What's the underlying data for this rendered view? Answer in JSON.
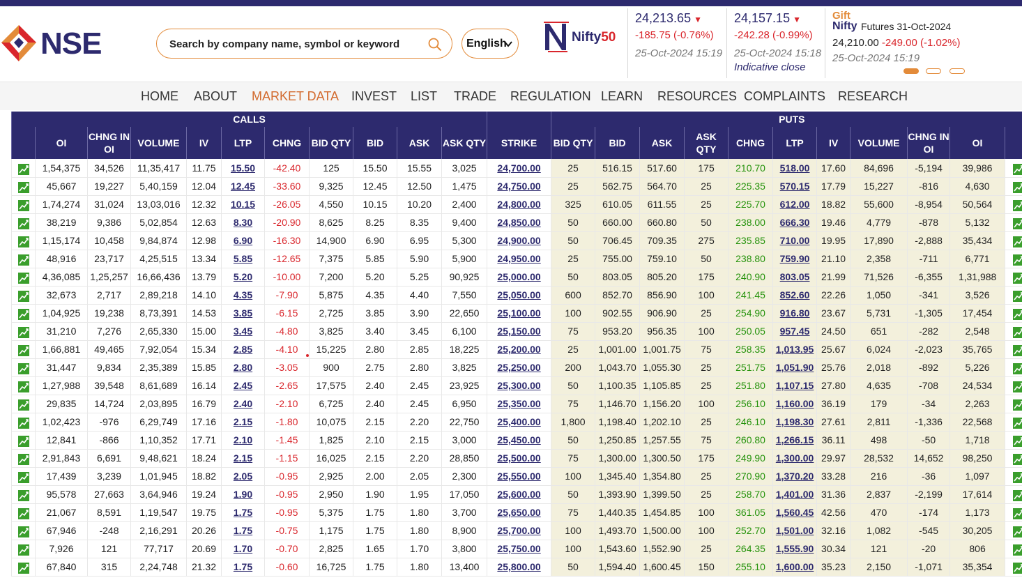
{
  "header": {
    "logo_text": "NSE",
    "search": {
      "placeholder": "Search by company name, symbol or keyword",
      "value": ""
    },
    "language": {
      "selected": "English"
    },
    "nifty_logo": {
      "brand": "Nifty",
      "suffix": "50"
    },
    "tickers": [
      {
        "value": "24,213.65",
        "change": "-185.75 (-0.76%)",
        "time": "25-Oct-2024 15:19",
        "note": ""
      },
      {
        "value": "24,157.15",
        "change": "-242.28 (-0.99%)",
        "time": "25-Oct-2024 15:18",
        "note": "Indicative close"
      }
    ],
    "gift": {
      "brand": "Gift",
      "nifty": "Nifty",
      "title": "Futures 31-Oct-2024",
      "price": "24,210.00",
      "change": "-249.00 (-1.02%)",
      "time": "25-Oct-2024 15:19"
    },
    "colors": {
      "brand": "#2d2a6e",
      "accent": "#e38b3a",
      "down": "#d9262c",
      "up": "#24920b",
      "puts_bg": "#f3f0dc"
    }
  },
  "nav": [
    "HOME",
    "ABOUT",
    "MARKET DATA",
    "INVEST",
    "LIST",
    "TRADE",
    "REGULATION",
    "LEARN",
    "RESOURCES",
    "COMPLAINTS",
    "RESEARCH"
  ],
  "nav_active": "MARKET DATA",
  "option_chain": {
    "calls_label": "CALLS",
    "puts_label": "PUTS",
    "columns": [
      "OI",
      "CHNG IN OI",
      "VOLUME",
      "IV",
      "LTP",
      "CHNG",
      "BID QTY",
      "BID",
      "ASK",
      "ASK QTY",
      "STRIKE",
      "BID QTY",
      "BID",
      "ASK",
      "ASK QTY",
      "CHNG",
      "LTP",
      "IV",
      "VOLUME",
      "CHNG IN OI",
      "OI"
    ],
    "rows": [
      [
        "1,54,375",
        "34,526",
        "11,35,417",
        "11.75",
        "15.50",
        "-42.40",
        "125",
        "15.50",
        "15.55",
        "3,025",
        "24,700.00",
        "25",
        "516.15",
        "517.60",
        "175",
        "210.70",
        "518.00",
        "17.60",
        "84,696",
        "-5,194",
        "39,986"
      ],
      [
        "45,667",
        "19,227",
        "5,40,159",
        "12.04",
        "12.45",
        "-33.60",
        "9,325",
        "12.45",
        "12.50",
        "1,475",
        "24,750.00",
        "25",
        "562.75",
        "564.70",
        "25",
        "225.35",
        "570.15",
        "17.79",
        "15,227",
        "-816",
        "4,630"
      ],
      [
        "1,74,274",
        "31,024",
        "13,03,016",
        "12.32",
        "10.15",
        "-26.05",
        "4,550",
        "10.15",
        "10.20",
        "2,400",
        "24,800.00",
        "325",
        "610.05",
        "611.55",
        "25",
        "225.70",
        "612.00",
        "18.82",
        "55,600",
        "-8,954",
        "50,564"
      ],
      [
        "38,219",
        "9,386",
        "5,02,854",
        "12.63",
        "8.30",
        "-20.90",
        "8,625",
        "8.25",
        "8.35",
        "9,400",
        "24,850.00",
        "50",
        "660.00",
        "660.80",
        "50",
        "238.00",
        "666.30",
        "19.46",
        "4,779",
        "-878",
        "5,132"
      ],
      [
        "1,15,174",
        "10,458",
        "9,84,874",
        "12.98",
        "6.90",
        "-16.30",
        "14,900",
        "6.90",
        "6.95",
        "5,300",
        "24,900.00",
        "50",
        "706.45",
        "709.35",
        "275",
        "235.85",
        "710.00",
        "19.95",
        "17,890",
        "-2,888",
        "35,434"
      ],
      [
        "48,916",
        "23,717",
        "4,25,515",
        "13.34",
        "5.85",
        "-12.65",
        "7,375",
        "5.85",
        "5.90",
        "5,900",
        "24,950.00",
        "25",
        "755.00",
        "759.10",
        "50",
        "238.80",
        "759.90",
        "21.10",
        "2,358",
        "-711",
        "6,771"
      ],
      [
        "4,36,085",
        "1,25,257",
        "16,66,436",
        "13.79",
        "5.20",
        "-10.00",
        "7,200",
        "5.20",
        "5.25",
        "90,925",
        "25,000.00",
        "50",
        "803.05",
        "805.20",
        "175",
        "240.90",
        "803.05",
        "21.99",
        "71,526",
        "-6,355",
        "1,31,988"
      ],
      [
        "32,673",
        "2,717",
        "2,89,218",
        "14.10",
        "4.35",
        "-7.90",
        "5,875",
        "4.35",
        "4.40",
        "7,550",
        "25,050.00",
        "600",
        "852.70",
        "856.90",
        "100",
        "241.45",
        "852.60",
        "22.26",
        "1,050",
        "-341",
        "3,526"
      ],
      [
        "1,04,925",
        "19,238",
        "8,73,391",
        "14.53",
        "3.85",
        "-6.15",
        "2,725",
        "3.85",
        "3.90",
        "22,650",
        "25,100.00",
        "100",
        "902.55",
        "906.90",
        "25",
        "254.90",
        "916.80",
        "23.67",
        "5,731",
        "-1,305",
        "17,454"
      ],
      [
        "31,210",
        "7,276",
        "2,65,330",
        "15.00",
        "3.45",
        "-4.80",
        "3,825",
        "3.40",
        "3.45",
        "6,100",
        "25,150.00",
        "75",
        "953.20",
        "956.35",
        "100",
        "250.05",
        "957.45",
        "24.50",
        "651",
        "-282",
        "2,548"
      ],
      [
        "1,66,881",
        "49,465",
        "7,92,054",
        "15.34",
        "2.85",
        "-4.10",
        "15,225",
        "2.80",
        "2.85",
        "18,225",
        "25,200.00",
        "25",
        "1,001.00",
        "1,001.75",
        "75",
        "258.35",
        "1,013.95",
        "25.67",
        "6,024",
        "-2,023",
        "35,765"
      ],
      [
        "31,447",
        "9,834",
        "2,35,389",
        "15.85",
        "2.80",
        "-3.05",
        "900",
        "2.75",
        "2.80",
        "3,825",
        "25,250.00",
        "200",
        "1,043.70",
        "1,055.30",
        "25",
        "251.75",
        "1,051.90",
        "25.76",
        "2,018",
        "-892",
        "5,226"
      ],
      [
        "1,27,988",
        "39,548",
        "8,61,689",
        "16.14",
        "2.45",
        "-2.65",
        "17,575",
        "2.40",
        "2.45",
        "23,925",
        "25,300.00",
        "50",
        "1,100.35",
        "1,105.85",
        "25",
        "251.80",
        "1,107.15",
        "27.80",
        "4,635",
        "-708",
        "24,534"
      ],
      [
        "29,835",
        "14,724",
        "2,03,895",
        "16.79",
        "2.40",
        "-2.10",
        "6,725",
        "2.40",
        "2.45",
        "6,950",
        "25,350.00",
        "75",
        "1,146.70",
        "1,156.20",
        "100",
        "256.10",
        "1,160.00",
        "36.19",
        "179",
        "-34",
        "2,263"
      ],
      [
        "1,02,423",
        "-976",
        "6,29,749",
        "17.16",
        "2.15",
        "-1.80",
        "10,075",
        "2.15",
        "2.20",
        "22,750",
        "25,400.00",
        "1,800",
        "1,198.40",
        "1,202.10",
        "25",
        "246.10",
        "1,198.30",
        "27.61",
        "2,811",
        "-1,336",
        "22,568"
      ],
      [
        "12,841",
        "-866",
        "1,10,352",
        "17.71",
        "2.10",
        "-1.45",
        "1,825",
        "2.10",
        "2.15",
        "3,000",
        "25,450.00",
        "50",
        "1,250.85",
        "1,257.55",
        "75",
        "260.80",
        "1,266.15",
        "36.11",
        "498",
        "-50",
        "1,718"
      ],
      [
        "2,91,843",
        "6,691",
        "9,48,621",
        "18.24",
        "2.15",
        "-1.15",
        "16,025",
        "2.15",
        "2.20",
        "28,850",
        "25,500.00",
        "75",
        "1,300.00",
        "1,300.50",
        "175",
        "249.90",
        "1,300.00",
        "29.97",
        "28,532",
        "14,652",
        "98,250"
      ],
      [
        "17,439",
        "3,239",
        "1,01,945",
        "18.82",
        "2.05",
        "-0.95",
        "2,925",
        "2.00",
        "2.05",
        "2,300",
        "25,550.00",
        "100",
        "1,345.40",
        "1,354.80",
        "25",
        "270.90",
        "1,370.20",
        "33.28",
        "216",
        "-36",
        "1,097"
      ],
      [
        "95,578",
        "27,663",
        "3,64,946",
        "19.24",
        "1.90",
        "-0.95",
        "2,950",
        "1.90",
        "1.95",
        "17,050",
        "25,600.00",
        "50",
        "1,393.90",
        "1,399.50",
        "25",
        "258.70",
        "1,401.00",
        "31.36",
        "2,837",
        "-2,199",
        "17,614"
      ],
      [
        "21,067",
        "8,591",
        "1,19,547",
        "19.75",
        "1.75",
        "-0.95",
        "5,375",
        "1.75",
        "1.80",
        "3,700",
        "25,650.00",
        "75",
        "1,440.35",
        "1,454.85",
        "100",
        "361.05",
        "1,560.45",
        "42.56",
        "470",
        "-174",
        "1,173"
      ],
      [
        "67,946",
        "-248",
        "2,16,291",
        "20.26",
        "1.75",
        "-0.75",
        "1,175",
        "1.75",
        "1.80",
        "8,900",
        "25,700.00",
        "100",
        "1,493.70",
        "1,500.00",
        "100",
        "252.70",
        "1,501.00",
        "32.16",
        "1,082",
        "-545",
        "30,205"
      ],
      [
        "7,926",
        "121",
        "77,717",
        "20.69",
        "1.70",
        "-0.70",
        "2,825",
        "1.65",
        "1.70",
        "3,800",
        "25,750.00",
        "100",
        "1,543.60",
        "1,552.90",
        "25",
        "264.35",
        "1,555.90",
        "30.34",
        "121",
        "-20",
        "806"
      ],
      [
        "67,840",
        "315",
        "2,24,748",
        "21.32",
        "1.75",
        "-0.60",
        "16,725",
        "1.75",
        "1.80",
        "13,400",
        "25,800.00",
        "50",
        "1,594.40",
        "1,600.45",
        "150",
        "255.10",
        "1,600.00",
        "35.23",
        "2,150",
        "-1,071",
        "35,354"
      ]
    ]
  }
}
